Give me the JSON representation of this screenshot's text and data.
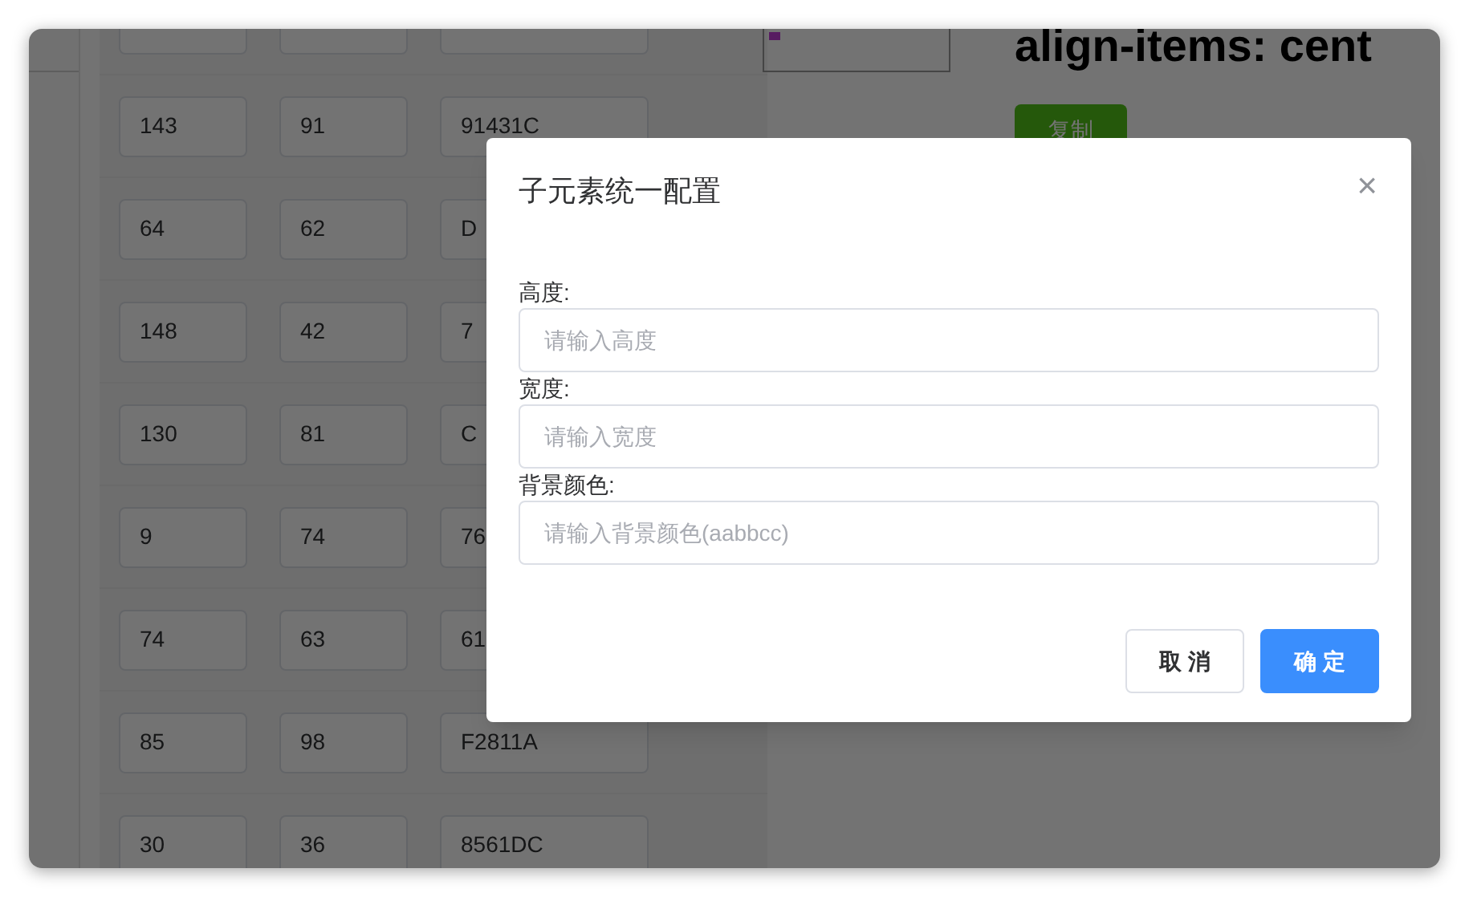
{
  "page": {
    "heading": "align-items: cent",
    "copy_button": "复制"
  },
  "grid_rows": [
    {
      "cells": [
        "143",
        "91",
        "91431C"
      ]
    },
    {
      "cells": [
        "64",
        "62",
        "D"
      ]
    },
    {
      "cells": [
        "148",
        "42",
        "7"
      ]
    },
    {
      "cells": [
        "130",
        "81",
        "C"
      ]
    },
    {
      "cells": [
        "9",
        "74",
        "76"
      ]
    },
    {
      "cells": [
        "74",
        "63",
        "61"
      ]
    },
    {
      "cells": [
        "85",
        "98",
        "F2811A"
      ]
    },
    {
      "cells": [
        "30",
        "36",
        "8561DC"
      ]
    }
  ],
  "dialog": {
    "title": "子元素统一配置",
    "close": "×",
    "fields": [
      {
        "label": "高度:",
        "placeholder": "请输入高度"
      },
      {
        "label": "宽度:",
        "placeholder": "请输入宽度"
      },
      {
        "label": "背景颜色:",
        "placeholder": "请输入背景颜色(aabbcc)"
      }
    ],
    "buttons": [
      {
        "label": "取 消",
        "kind": "secondary"
      },
      {
        "label": "确 定",
        "kind": "primary"
      }
    ]
  }
}
